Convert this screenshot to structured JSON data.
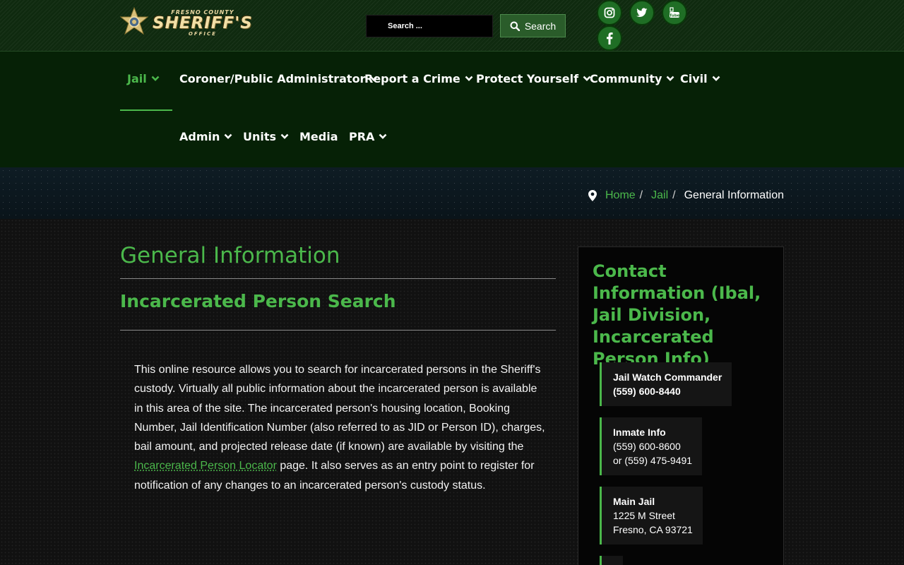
{
  "logo": {
    "small": "FRESNO COUNTY",
    "big": "SHERIFF'S",
    "sub": "OFFICE"
  },
  "search": {
    "placeholder": "Search ...",
    "button_label": "Search"
  },
  "social": [
    "instagram-icon",
    "twitter-icon",
    "youtube-icon",
    "facebook-icon"
  ],
  "nav": {
    "row1": [
      {
        "label": "Jail",
        "dropdown": true,
        "active": true
      },
      {
        "label": "Coroner/Public Administrator",
        "dropdown": true
      },
      {
        "label": "Report a Crime",
        "dropdown": true
      },
      {
        "label": "Protect Yourself",
        "dropdown": true
      },
      {
        "label": "Community",
        "dropdown": true
      },
      {
        "label": "Civil",
        "dropdown": true
      }
    ],
    "row2": [
      {
        "label": "Admin",
        "dropdown": true
      },
      {
        "label": "Units",
        "dropdown": true
      },
      {
        "label": "Media",
        "dropdown": false
      },
      {
        "label": "PRA",
        "dropdown": true
      }
    ]
  },
  "breadcrumb": {
    "home": "Home",
    "jail": "Jail",
    "sep": "/",
    "current": "General Information"
  },
  "main": {
    "title": "General Information",
    "subtitle": "Incarcerated Person Search",
    "para_before": "This online resource allows you to search for incarcerated persons in the Sheriff's custody. Virtually all public information about the incarcerated person is available in this area of the site. The incarcerated person's housing location, Booking Number, Jail Identification Number (also referred to as JID or Person ID), charges, bail amount, and projected release date (if known) are available by visiting the ",
    "link": "Incarcerated Person Locator",
    "para_after": " page. It also serves as an entry point to register for notification of any changes to an incarcerated person's custody status."
  },
  "sidebar": {
    "title": "Contact Information (Ibal, Jail Division, Incarcerated Person Info)",
    "cards": [
      {
        "head": "Jail Watch Commander",
        "line1": "(559) 600-8440",
        "line2": ""
      },
      {
        "head": "Inmate Info",
        "line1": "(559) 600-8600",
        "line2": "or (559) 475-9491"
      },
      {
        "head": "Main Jail",
        "line1": "1225 M Street",
        "line2": "Fresno, CA 93721"
      }
    ]
  },
  "colors": {
    "accent": "#4bb84b",
    "nav_bg": "#062106",
    "topbar_bg": "#0f2a0f"
  }
}
